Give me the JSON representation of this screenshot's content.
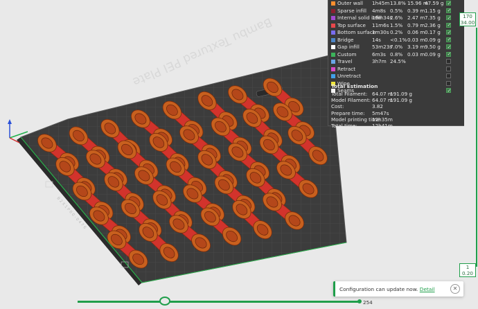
{
  "plate_label": "Bambu Textured PEI Plate",
  "legend": {
    "rows": [
      {
        "name": "Outer wall",
        "time": "1h45m",
        "pct": "13.8%",
        "len": "15.96 m",
        "wt": "47.59 g",
        "color": "#ff8f2f",
        "visible": true
      },
      {
        "name": "Sparse infill",
        "time": "4m8s",
        "pct": "0.5%",
        "len": "0.39 m",
        "wt": "1.15 g",
        "color": "#8c1f2f",
        "visible": true
      },
      {
        "name": "Internal solid infill",
        "time": "19m34s",
        "pct": "2.6%",
        "len": "2.47 m",
        "wt": "7.35 g",
        "color": "#a44bd0",
        "visible": true
      },
      {
        "name": "Top surface",
        "time": "11m6s",
        "pct": "1.5%",
        "len": "0.79 m",
        "wt": "2.36 g",
        "color": "#e8474b",
        "visible": true
      },
      {
        "name": "Bottom surface",
        "time": "1m30s",
        "pct": "0.2%",
        "len": "0.06 m",
        "wt": "0.17 g",
        "color": "#7a6df0",
        "visible": true
      },
      {
        "name": "Bridge",
        "time": "14s",
        "pct": "<0.1%",
        "len": "0.03 m",
        "wt": "0.09 g",
        "color": "#4d86c7",
        "visible": true
      },
      {
        "name": "Gap infill",
        "time": "53m23s",
        "pct": "7.0%",
        "len": "3.19 m",
        "wt": "9.50 g",
        "color": "#ffffff",
        "visible": true
      },
      {
        "name": "Custom",
        "time": "6m3s",
        "pct": "0.8%",
        "len": "0.03 m",
        "wt": "0.09 g",
        "color": "#3bb35a",
        "visible": true
      },
      {
        "name": "Travel",
        "time": "3h7m",
        "pct": "24.5%",
        "len": "",
        "wt": "",
        "color": "#6aa6e6",
        "visible": false
      },
      {
        "name": "Retract",
        "time": "",
        "pct": "",
        "len": "",
        "wt": "",
        "color": "#d84ac4",
        "visible": false
      },
      {
        "name": "Unretract",
        "time": "",
        "pct": "",
        "len": "",
        "wt": "",
        "color": "#41a0e8",
        "visible": false
      },
      {
        "name": "Wipe",
        "time": "",
        "pct": "",
        "len": "",
        "wt": "",
        "color": "#f0e63c",
        "visible": false
      },
      {
        "name": "Seams",
        "time": "",
        "pct": "",
        "len": "",
        "wt": "",
        "color": "#f5f5f5",
        "visible": true
      }
    ]
  },
  "estimation": {
    "title": "Total Estimation",
    "rows": [
      {
        "label": "Total Filament:",
        "value": "64.07 m",
        "value2": "191.09 g"
      },
      {
        "label": "Model Filament:",
        "value": "64.07 m",
        "value2": "191.09 g"
      },
      {
        "label": "Cost:",
        "value": "3.82",
        "value2": ""
      },
      {
        "label": "Prepare time:",
        "value": "5m47s",
        "value2": ""
      },
      {
        "label": "Model printing time:",
        "value": "12h35m",
        "value2": ""
      },
      {
        "label": "Total time:",
        "value": "12h41m",
        "value2": ""
      }
    ]
  },
  "layer_slider": {
    "top_value": "170",
    "top_height": "34.00",
    "bottom_value": "1",
    "bottom_height": "0.20"
  },
  "move_slider": {
    "value": "254"
  },
  "notification": {
    "text": "Configuration can update now.",
    "link": "Detail"
  },
  "colors": {
    "accent": "#1f9e4a",
    "model": "#c85a1e",
    "plate": "#3c3c3c",
    "panel": "#3a3a3a"
  }
}
